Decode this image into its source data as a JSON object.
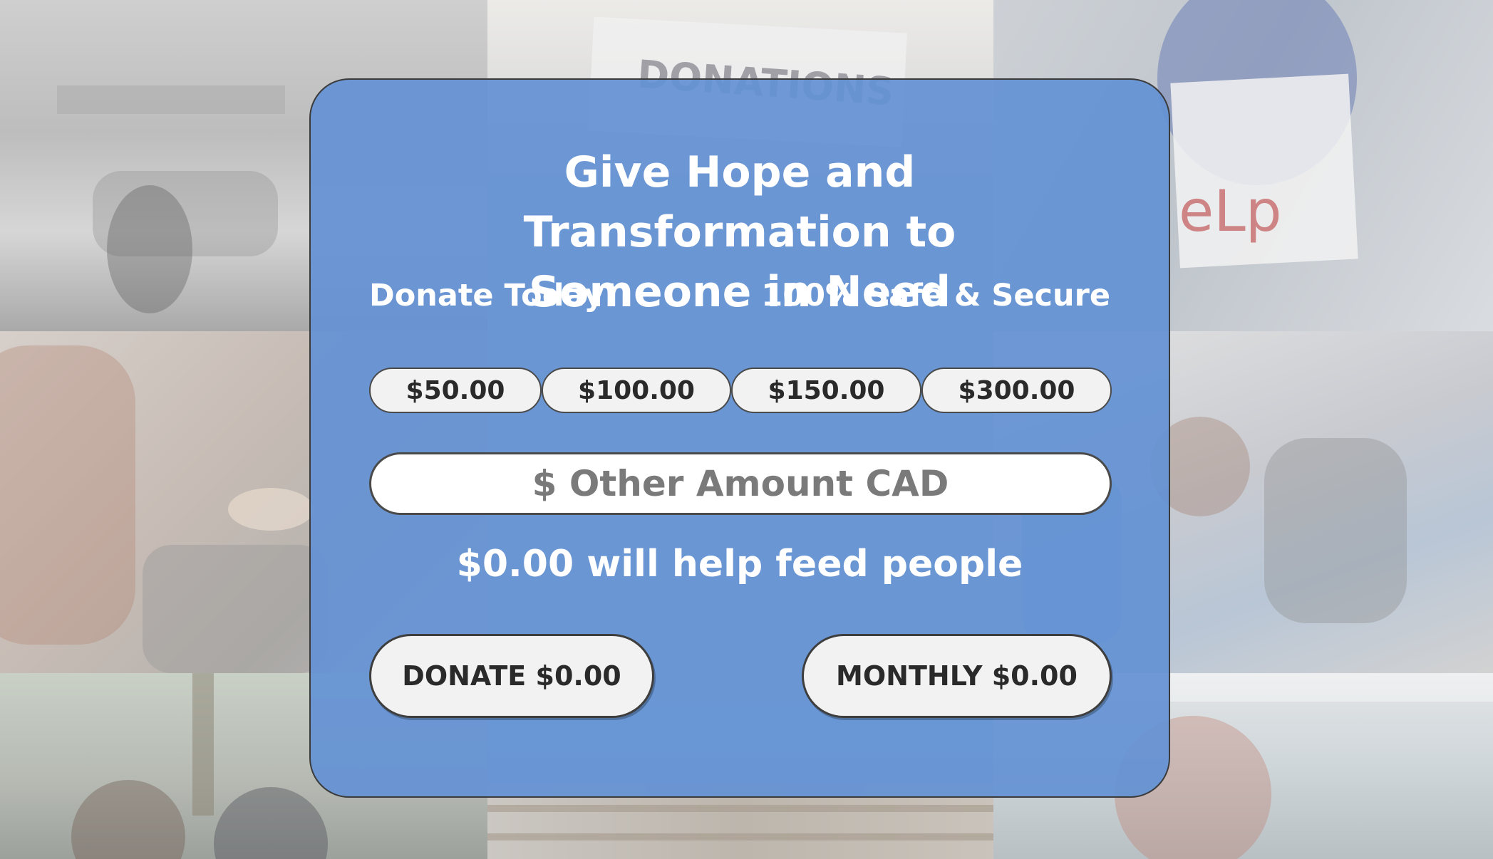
{
  "card": {
    "headline": "Give Hope and Transformation to Someone in Need",
    "donate_today": "Donate Today!",
    "safe_secure": "100% Safe & Secure",
    "presets": [
      "$50.00",
      "$100.00",
      "$150.00",
      "$300.00"
    ],
    "other_amount_placeholder": "$ Other Amount CAD",
    "impact_text": "$0.00 will help feed people",
    "donate_button": "DONATE $0.00",
    "monthly_button": "MONTHLY $0.00"
  },
  "background": {
    "sign_donations": "DONATIONS",
    "sign_help": "eLp"
  },
  "colors": {
    "card_fill": "#6492d4",
    "button_fill": "#f2f2f2",
    "text_light": "#ffffff",
    "text_dark": "#2a2a2a"
  }
}
